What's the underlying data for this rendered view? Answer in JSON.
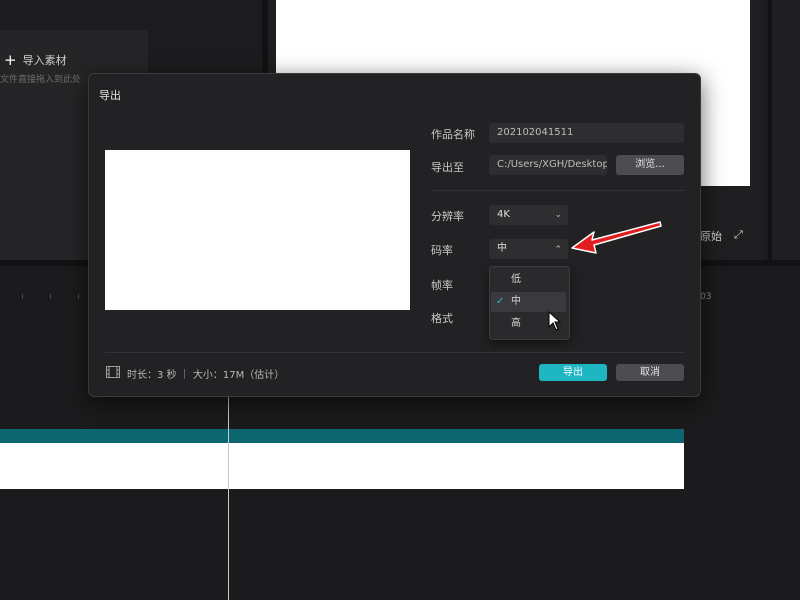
{
  "background": {
    "import_label": "导入素材",
    "import_hint": "文件直接拖入到此处",
    "preview_controls": [
      "原始",
      "⤢"
    ],
    "timecode": "03"
  },
  "dialog": {
    "title": "导出",
    "fields": {
      "name_label": "作品名称",
      "name_value": "202102041511",
      "path_label": "导出至",
      "path_value": "C:/Users/XGH/Desktop",
      "browse_label": "浏览...",
      "resolution_label": "分辨率",
      "resolution_value": "4K",
      "bitrate_label": "码率",
      "bitrate_value": "中",
      "framerate_label": "帧率",
      "format_label": "格式"
    },
    "bitrate_options": [
      "低",
      "中",
      "高"
    ],
    "bitrate_selected": "中",
    "footer": {
      "info": "时长：3 秒 ｜ 大小：17M（估计）"
    },
    "buttons": {
      "export": "导出",
      "cancel": "取消"
    }
  },
  "colors": {
    "accent": "#1fb6c4",
    "annotation_arrow": "#e11d1d"
  }
}
